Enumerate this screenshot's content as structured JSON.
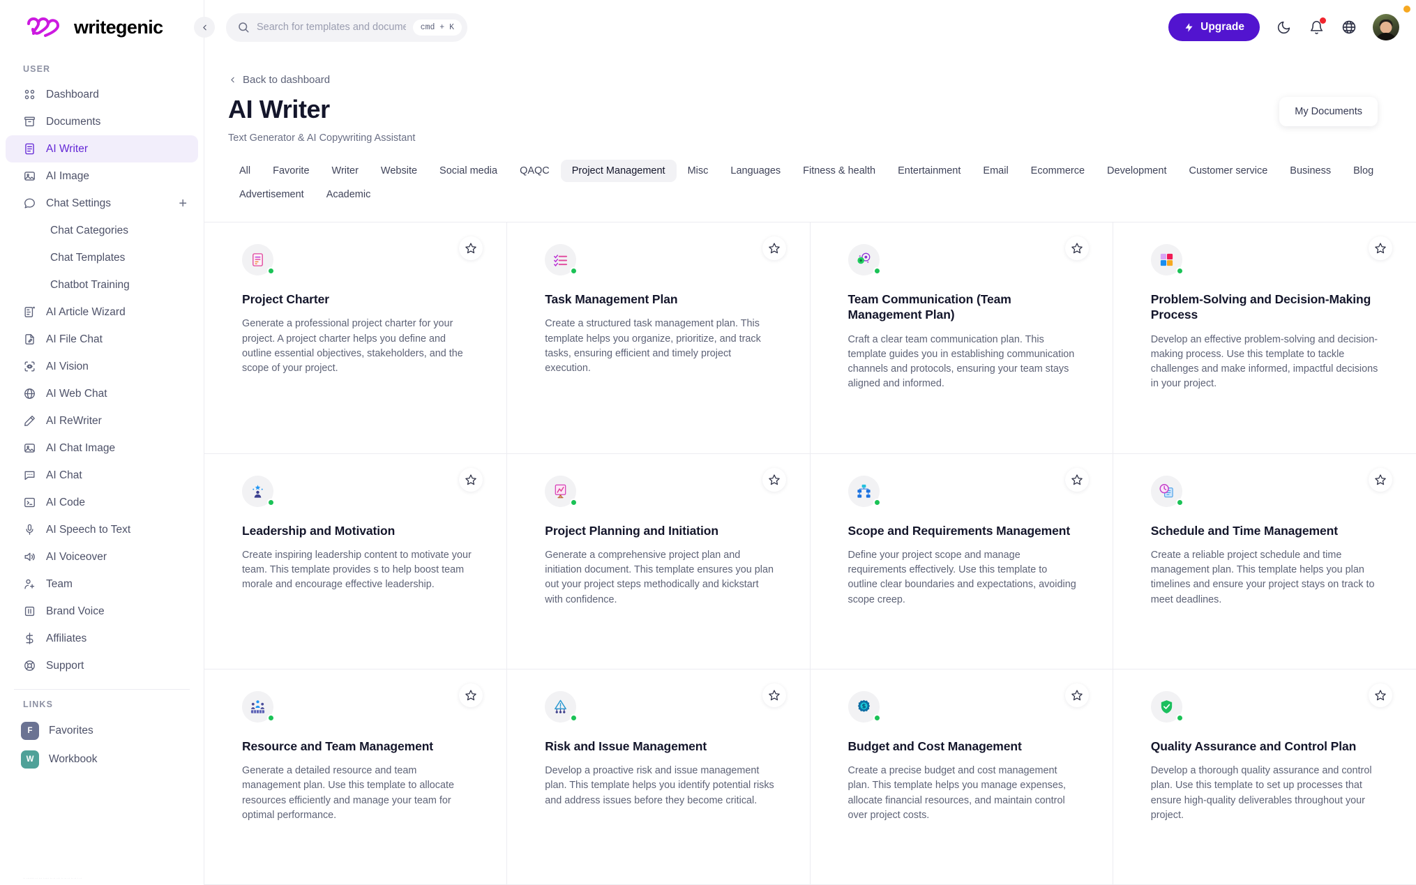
{
  "brand": {
    "name": "writegenic",
    "accent": "#b822e0",
    "purple": "#5214cf"
  },
  "sidebar": {
    "user_label": "USER",
    "links_label": "LINKS",
    "items": [
      {
        "label": "Dashboard",
        "icon": "grid-icon",
        "active": false,
        "sub": false
      },
      {
        "label": "Documents",
        "icon": "archive-icon",
        "active": false,
        "sub": false
      },
      {
        "label": "AI Writer",
        "icon": "document-icon",
        "active": true,
        "sub": false
      },
      {
        "label": "AI Image",
        "icon": "image-icon",
        "active": false,
        "sub": false
      },
      {
        "label": "Chat Settings",
        "icon": "chat-bubble-icon",
        "active": false,
        "sub": false,
        "plus": "+"
      },
      {
        "label": "Chat Categories",
        "icon": "",
        "active": false,
        "sub": true
      },
      {
        "label": "Chat Templates",
        "icon": "",
        "active": false,
        "sub": true
      },
      {
        "label": "Chatbot Training",
        "icon": "",
        "active": false,
        "sub": true
      },
      {
        "label": "AI Article Wizard",
        "icon": "article-icon",
        "active": false,
        "sub": false
      },
      {
        "label": "AI File Chat",
        "icon": "file-pen-icon",
        "active": false,
        "sub": false
      },
      {
        "label": "AI Vision",
        "icon": "eye-scan-icon",
        "active": false,
        "sub": false
      },
      {
        "label": "AI Web Chat",
        "icon": "globe-www-icon",
        "active": false,
        "sub": false
      },
      {
        "label": "AI ReWriter",
        "icon": "pencil-icon",
        "active": false,
        "sub": false
      },
      {
        "label": "AI Chat Image",
        "icon": "image-icon",
        "active": false,
        "sub": false
      },
      {
        "label": "AI Chat",
        "icon": "chat-dots-icon",
        "active": false,
        "sub": false
      },
      {
        "label": "AI Code",
        "icon": "terminal-icon",
        "active": false,
        "sub": false
      },
      {
        "label": "AI Speech to Text",
        "icon": "microphone-icon",
        "active": false,
        "sub": false
      },
      {
        "label": "AI Voiceover",
        "icon": "speaker-icon",
        "active": false,
        "sub": false
      },
      {
        "label": "Team",
        "icon": "user-plus-icon",
        "active": false,
        "sub": false
      },
      {
        "label": "Brand Voice",
        "icon": "board-icon",
        "active": false,
        "sub": false
      },
      {
        "label": "Affiliates",
        "icon": "dollar-icon",
        "active": false,
        "sub": false
      },
      {
        "label": "Support",
        "icon": "lifebuoy-icon",
        "active": false,
        "sub": false
      }
    ],
    "links": [
      {
        "label": "Favorites",
        "initial": "F",
        "color": "#6b7393"
      },
      {
        "label": "Workbook",
        "initial": "W",
        "color": "#4fa198"
      }
    ]
  },
  "topbar": {
    "collapse_icon": "chevron-left-icon",
    "search_placeholder": "Search for templates and documents...",
    "search_value": "",
    "kbd_hint": "cmd + K",
    "upgrade_label": "Upgrade",
    "theme_icon": "moon-icon",
    "notification_icon": "bell-icon",
    "language_icon": "globe-icon",
    "avatar_icon": "user-avatar"
  },
  "page": {
    "back_label": "Back to dashboard",
    "title": "AI Writer",
    "subtitle": "Text Generator & AI Copywriting Assistant",
    "my_documents_label": "My Documents"
  },
  "tabs": [
    {
      "label": "All",
      "active": false
    },
    {
      "label": "Favorite",
      "active": false
    },
    {
      "label": "Writer",
      "active": false
    },
    {
      "label": "Website",
      "active": false
    },
    {
      "label": "Social media",
      "active": false
    },
    {
      "label": "QAQC",
      "active": false
    },
    {
      "label": "Project Management",
      "active": true
    },
    {
      "label": "Misc",
      "active": false
    },
    {
      "label": "Languages",
      "active": false
    },
    {
      "label": "Fitness & health",
      "active": false
    },
    {
      "label": "Entertainment",
      "active": false
    },
    {
      "label": "Email",
      "active": false
    },
    {
      "label": "Ecommerce",
      "active": false
    },
    {
      "label": "Development",
      "active": false
    },
    {
      "label": "Customer service",
      "active": false
    },
    {
      "label": "Business",
      "active": false
    },
    {
      "label": "Blog",
      "active": false
    },
    {
      "label": "Advertisement",
      "active": false
    },
    {
      "label": "Academic",
      "active": false
    }
  ],
  "cards": [
    {
      "title": "Project Charter",
      "desc": "Generate a professional project charter for your project. A project charter helps you define and outline essential objectives, stakeholders, and the scope of your project.",
      "icon": "document-list-icon",
      "status": "active"
    },
    {
      "title": "Task Management Plan",
      "desc": "Create a structured task management plan. This template helps you organize, prioritize, and track tasks, ensuring efficient and timely project execution.",
      "icon": "checklist-icon",
      "status": "active"
    },
    {
      "title": "Team Communication (Team Management Plan)",
      "desc": "Craft a clear team communication plan. This template guides you in establishing communication channels and protocols, ensuring your team stays aligned and informed.",
      "icon": "team-communication-icon",
      "status": "active"
    },
    {
      "title": "Problem-Solving and Decision-Making Process",
      "desc": "Develop an effective problem-solving and decision-making process. Use this template to tackle challenges and make informed, impactful decisions in your project.",
      "icon": "puzzle-icon",
      "status": "active"
    },
    {
      "title": "Leadership and Motivation",
      "desc": "Create inspiring leadership content to motivate your team. This template provides s to help boost team morale and encourage effective leadership.",
      "icon": "leadership-icon",
      "status": "active"
    },
    {
      "title": "Project Planning and Initiation",
      "desc": "Generate a comprehensive project plan and initiation document. This template ensures you plan out your project steps methodically and kickstart with confidence.",
      "icon": "flipchart-icon",
      "status": "active"
    },
    {
      "title": "Scope and Requirements Management",
      "desc": "Define your project scope and manage requirements effectively. Use this template to outline clear boundaries and expectations, avoiding scope creep.",
      "icon": "hierarchy-icon",
      "status": "active"
    },
    {
      "title": "Schedule and Time Management",
      "desc": "Create a reliable project schedule and time management plan. This template helps you plan timelines and ensure your project stays on track to meet deadlines.",
      "icon": "clock-calendar-icon",
      "status": "active"
    },
    {
      "title": "Resource and Team Management",
      "desc": "Generate a detailed resource and team management plan. Use this template to allocate resources efficiently and manage your team for optimal performance.",
      "icon": "resource-team-icon",
      "status": "active"
    },
    {
      "title": "Risk and Issue Management",
      "desc": "Develop a proactive risk and issue management plan. This template helps you identify potential risks and address issues before they become critical.",
      "icon": "risk-warning-icon",
      "status": "active"
    },
    {
      "title": "Budget and Cost Management",
      "desc": "Create a precise budget and cost management plan. This template helps you manage expenses, allocate financial resources, and maintain control over project costs.",
      "icon": "budget-gear-icon",
      "status": "active"
    },
    {
      "title": "Quality Assurance and Control Plan",
      "desc": "Develop a thorough quality assurance and control plan. Use this template to set up processes that ensure high-quality deliverables throughout your project.",
      "icon": "shield-check-icon",
      "status": "active"
    }
  ]
}
